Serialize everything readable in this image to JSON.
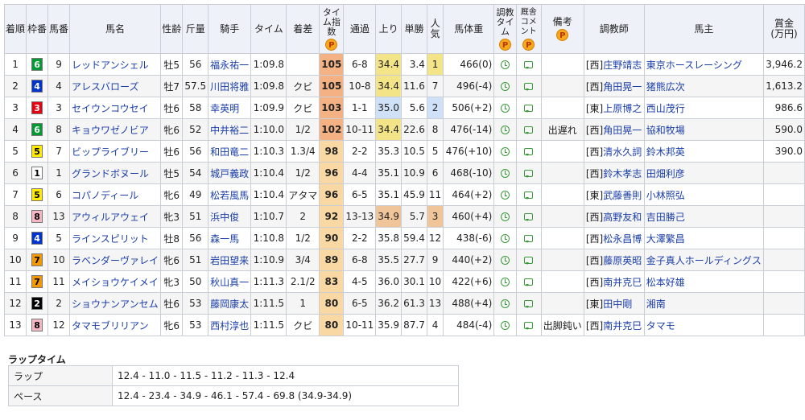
{
  "headers": {
    "rank": "着順",
    "waku": "枠番",
    "umaban": "馬番",
    "horse": "馬名",
    "sexage": "性齢",
    "weight": "斤量",
    "jockey": "騎手",
    "time": "タイム",
    "margin": "着差",
    "index": "タイム指数",
    "passing": "通過",
    "agari": "上り",
    "odds": "単勝",
    "popularity": "人気",
    "body_weight": "馬体重",
    "training_time": "調教タイム",
    "stable_comment": "厩舎コメント",
    "remarks": "備考",
    "trainer": "調教師",
    "owner": "馬主",
    "prize": "賞金(万円)"
  },
  "p_label": "P",
  "rows": [
    {
      "rank": "1",
      "waku": "6",
      "umaban": "9",
      "horse": "レッドアンシェル",
      "sexage": "牡5",
      "weight": "56",
      "jockey": "福永祐一",
      "time": "1:09.8",
      "margin": "",
      "index": "105",
      "passing": "6-8",
      "agari": "34.4",
      "odds": "3.4",
      "pop": "1",
      "bw": "466(0)",
      "remark": "",
      "region": "[西]",
      "trainer": "庄野靖志",
      "owner": "東京ホースレーシング",
      "prize": "3,946.2"
    },
    {
      "rank": "2",
      "waku": "4",
      "umaban": "4",
      "horse": "アレスバローズ",
      "sexage": "牡7",
      "weight": "57.5",
      "jockey": "川田将雅",
      "time": "1:09.8",
      "margin": "クビ",
      "index": "105",
      "passing": "10-8",
      "agari": "34.4",
      "odds": "11.6",
      "pop": "7",
      "bw": "496(-4)",
      "remark": "",
      "region": "[西]",
      "trainer": "角田晃一",
      "owner": "猪熊広次",
      "prize": "1,613.2"
    },
    {
      "rank": "3",
      "waku": "3",
      "umaban": "3",
      "horse": "セイウンコウセイ",
      "sexage": "牡6",
      "weight": "58",
      "jockey": "幸英明",
      "time": "1:09.9",
      "margin": "クビ",
      "index": "103",
      "passing": "1-1",
      "agari": "35.0",
      "odds": "5.6",
      "pop": "2",
      "bw": "506(+2)",
      "remark": "",
      "region": "[東]",
      "trainer": "上原博之",
      "owner": "西山茂行",
      "prize": "986.6"
    },
    {
      "rank": "4",
      "waku": "6",
      "umaban": "8",
      "horse": "キョウワゼノビア",
      "sexage": "牝6",
      "weight": "52",
      "jockey": "中井裕二",
      "time": "1:10.0",
      "margin": "1/2",
      "index": "102",
      "passing": "10-11",
      "agari": "34.4",
      "odds": "22.6",
      "pop": "8",
      "bw": "476(-14)",
      "remark": "出遅れ",
      "region": "[西]",
      "trainer": "角田晃一",
      "owner": "協和牧場",
      "prize": "590.0"
    },
    {
      "rank": "5",
      "waku": "5",
      "umaban": "7",
      "horse": "ビップライブリー",
      "sexage": "牡6",
      "weight": "56",
      "jockey": "和田竜二",
      "time": "1:10.3",
      "margin": "1.3/4",
      "index": "98",
      "passing": "2-2",
      "agari": "35.3",
      "odds": "10.5",
      "pop": "5",
      "bw": "476(+10)",
      "remark": "",
      "region": "[西]",
      "trainer": "清水久詞",
      "owner": "鈴木邦英",
      "prize": "390.0"
    },
    {
      "rank": "6",
      "waku": "1",
      "umaban": "1",
      "horse": "グランドボヌール",
      "sexage": "牡5",
      "weight": "54",
      "jockey": "城戸義政",
      "time": "1:10.4",
      "margin": "1/2",
      "index": "96",
      "passing": "4-4",
      "agari": "35.1",
      "odds": "10.9",
      "pop": "6",
      "bw": "468(-10)",
      "remark": "",
      "region": "[西]",
      "trainer": "鈴木孝志",
      "owner": "田畑利彦",
      "prize": ""
    },
    {
      "rank": "7",
      "waku": "5",
      "umaban": "6",
      "horse": "コパノディール",
      "sexage": "牝6",
      "weight": "49",
      "jockey": "松若風馬",
      "time": "1:10.4",
      "margin": "アタマ",
      "index": "96",
      "passing": "6-5",
      "agari": "35.1",
      "odds": "45.9",
      "pop": "11",
      "bw": "464(+2)",
      "remark": "",
      "region": "[東]",
      "trainer": "武藤善則",
      "owner": "小林照弘",
      "prize": ""
    },
    {
      "rank": "8",
      "waku": "8",
      "umaban": "13",
      "horse": "アウィルアウェイ",
      "sexage": "牝3",
      "weight": "51",
      "jockey": "浜中俊",
      "time": "1:10.7",
      "margin": "2",
      "index": "92",
      "passing": "13-13",
      "agari": "34.9",
      "odds": "5.7",
      "pop": "3",
      "bw": "460(+4)",
      "remark": "",
      "region": "[西]",
      "trainer": "高野友和",
      "owner": "吉田勝己",
      "prize": ""
    },
    {
      "rank": "9",
      "waku": "4",
      "umaban": "5",
      "horse": "ラインスピリット",
      "sexage": "牡8",
      "weight": "56",
      "jockey": "森一馬",
      "time": "1:10.8",
      "margin": "1/2",
      "index": "90",
      "passing": "2-2",
      "agari": "35.8",
      "odds": "59.4",
      "pop": "12",
      "bw": "438(-6)",
      "remark": "",
      "region": "[西]",
      "trainer": "松永昌博",
      "owner": "大澤繁昌",
      "prize": ""
    },
    {
      "rank": "10",
      "waku": "7",
      "umaban": "10",
      "horse": "ラベンダーヴァレイ",
      "sexage": "牝6",
      "weight": "51",
      "jockey": "岩田望来",
      "time": "1:10.9",
      "margin": "3/4",
      "index": "89",
      "passing": "6-8",
      "agari": "35.5",
      "odds": "27.7",
      "pop": "9",
      "bw": "440(+2)",
      "remark": "",
      "region": "[西]",
      "trainer": "藤原英昭",
      "owner": "金子真人ホールディングス",
      "prize": ""
    },
    {
      "rank": "11",
      "waku": "7",
      "umaban": "11",
      "horse": "メイショウケイメイ",
      "sexage": "牝3",
      "weight": "50",
      "jockey": "秋山真一",
      "time": "1:11.3",
      "margin": "2.1/2",
      "index": "83",
      "passing": "4-5",
      "agari": "36.0",
      "odds": "30.1",
      "pop": "10",
      "bw": "422(+6)",
      "remark": "",
      "region": "[西]",
      "trainer": "南井克巳",
      "owner": "松本好雄",
      "prize": ""
    },
    {
      "rank": "12",
      "waku": "2",
      "umaban": "2",
      "horse": "ショウナンアンセム",
      "sexage": "牡6",
      "weight": "53",
      "jockey": "藤岡康太",
      "time": "1:11.5",
      "margin": "1",
      "index": "80",
      "passing": "6-5",
      "agari": "36.2",
      "odds": "61.3",
      "pop": "13",
      "bw": "488(+4)",
      "remark": "",
      "region": "[東]",
      "trainer": "田中剛",
      "owner": "湘南",
      "prize": ""
    },
    {
      "rank": "13",
      "waku": "8",
      "umaban": "12",
      "horse": "タマモブリリアン",
      "sexage": "牝6",
      "weight": "53",
      "jockey": "西村淳也",
      "time": "1:11.5",
      "margin": "クビ",
      "index": "80",
      "passing": "10-11",
      "agari": "35.9",
      "odds": "87.7",
      "pop": "4",
      "bw": "484(-4)",
      "remark": "出脚鈍い",
      "region": "[西]",
      "trainer": "南井克巳",
      "owner": "タマモ",
      "prize": ""
    }
  ],
  "laps": {
    "title": "ラップタイム",
    "lap_label": "ラップ",
    "lap_value": "12.4 - 11.0 - 11.5 - 11.2 - 11.3 - 12.4",
    "pace_label": "ペース",
    "pace_value": "12.4 - 23.4 - 34.9 - 46.1 - 57.4 - 69.8 (34.9-34.9)"
  },
  "colors": {
    "waku1": "#ffffff",
    "waku2": "#000000",
    "waku3": "#e60012",
    "waku4": "#0033cc",
    "waku5": "#ffea00",
    "waku6": "#009933",
    "waku7": "#f39800",
    "waku8": "#f7b6c4",
    "index_high": "#f4b183",
    "index_mid": "#f9d8a4"
  }
}
